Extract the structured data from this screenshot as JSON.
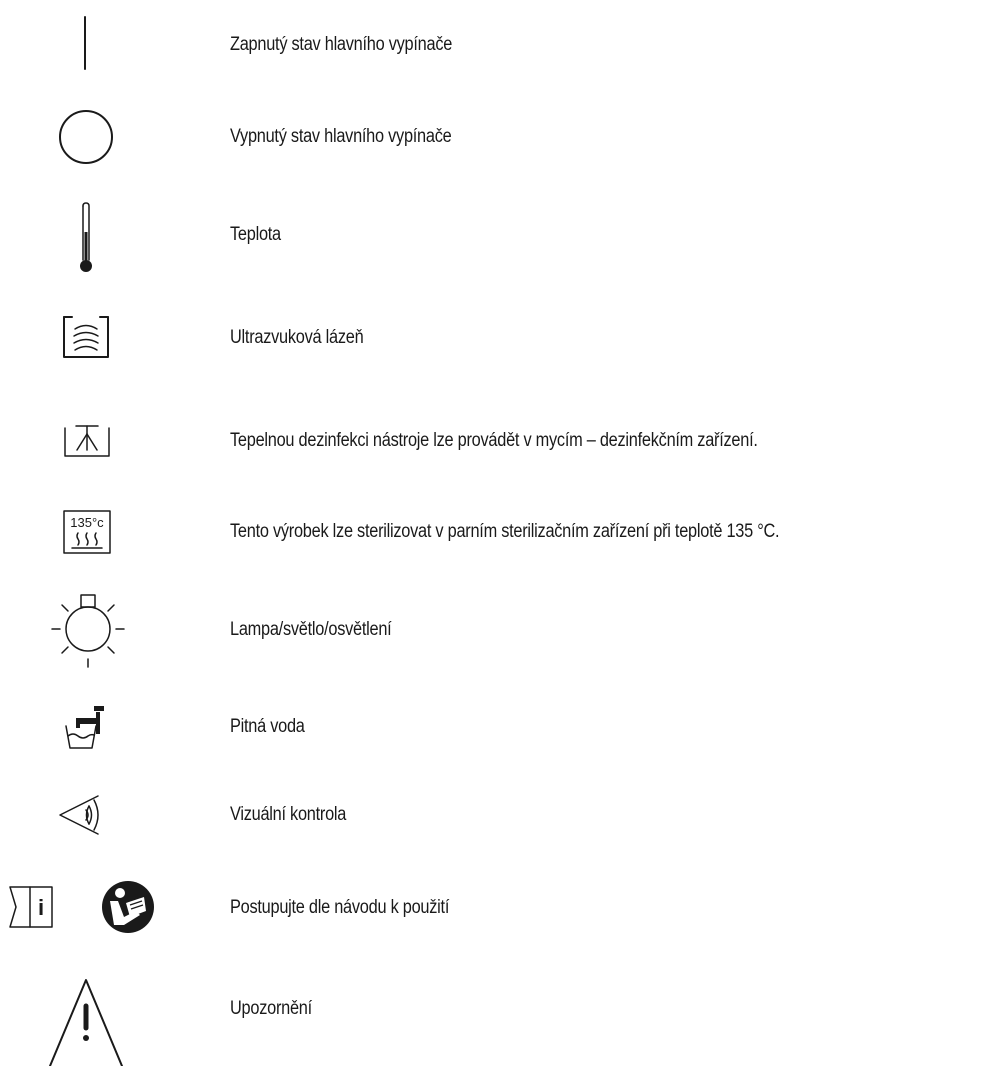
{
  "symbols": [
    {
      "icon": "power-on-line-icon",
      "label": "Zapnutý stav hlavního vypínače"
    },
    {
      "icon": "power-off-circle-icon",
      "label": "Vypnutý stav hlavního vypínače"
    },
    {
      "icon": "thermometer-icon",
      "label": "Teplota"
    },
    {
      "icon": "ultrasonic-bath-icon",
      "label": "Ultrazvuková lázeň"
    },
    {
      "icon": "thermal-disinfection-icon",
      "label": "Tepelnou dezinfekci nástroje lze provádět v mycím – dezinfekčním zařízení."
    },
    {
      "icon": "steam-sterilization-135-icon",
      "label": "Tento výrobek lze sterilizovat v parním sterilizačním zařízení při teplotě 135 °C.",
      "badge_text": "135°c"
    },
    {
      "icon": "lamp-icon",
      "label": "Lampa/světlo/osvětlení"
    },
    {
      "icon": "drinking-water-icon",
      "label": "Pitná voda"
    },
    {
      "icon": "visual-inspection-icon",
      "label": "Vizuální kontrola"
    },
    {
      "icon": "instructions-for-use-icon",
      "label": "Postupujte dle návodu k použití"
    },
    {
      "icon": "warning-icon",
      "label": "Upozornění"
    }
  ]
}
